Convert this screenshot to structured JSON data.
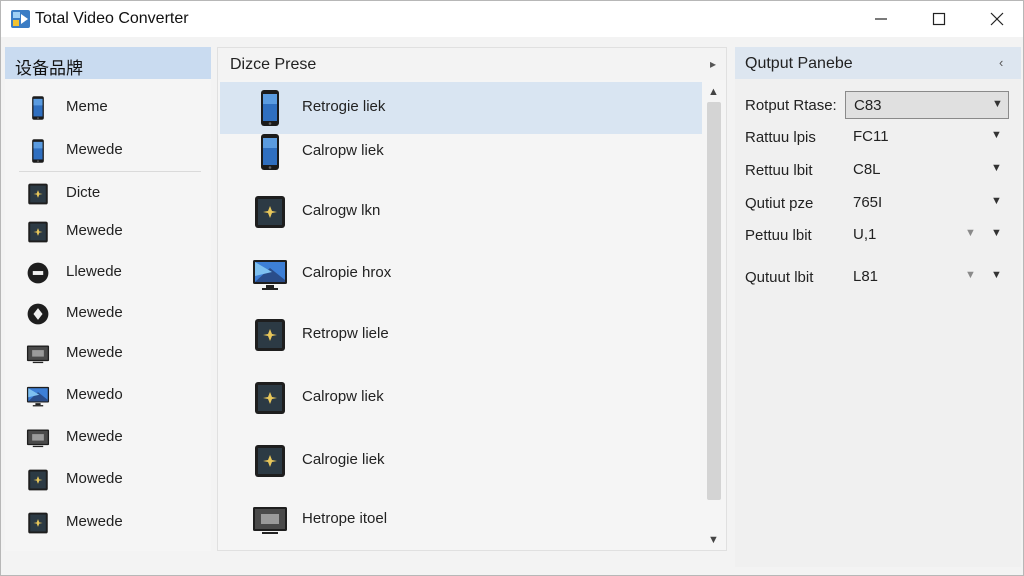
{
  "window": {
    "title": "Total Video Converter"
  },
  "left_panel": {
    "header": "设备品牌",
    "items": [
      {
        "label": "Meme",
        "icon": "phone-icon"
      },
      {
        "label": "Mewede",
        "icon": "phone-icon"
      },
      {
        "label": "Dicte",
        "icon": "tablet-icon"
      },
      {
        "label": "Mewede",
        "icon": "tablet-icon"
      },
      {
        "label": "Llewede",
        "icon": "round-device-icon"
      },
      {
        "label": "Mewede",
        "icon": "diamond-device-icon"
      },
      {
        "label": "Mewede",
        "icon": "tv-icon"
      },
      {
        "label": "Mewedo",
        "icon": "monitor-icon"
      },
      {
        "label": "Mewede",
        "icon": "tv-icon"
      },
      {
        "label": "Mowede",
        "icon": "tablet-icon"
      },
      {
        "label": "Mewede",
        "icon": "tablet-icon"
      }
    ]
  },
  "mid_panel": {
    "header": "Dizce Prese",
    "items": [
      {
        "label": "Retrogie liek",
        "icon": "phone-icon",
        "selected": true
      },
      {
        "label": "Calropw liek",
        "icon": "phone-icon",
        "selected": false
      },
      {
        "label": "Calrogw lkn",
        "icon": "tablet-icon",
        "selected": false
      },
      {
        "label": "Calropie hrox",
        "icon": "monitor-icon",
        "selected": false
      },
      {
        "label": "Retropw liele",
        "icon": "tablet-icon",
        "selected": false
      },
      {
        "label": "Calropw liek",
        "icon": "tablet-icon",
        "selected": false
      },
      {
        "label": "Calrogie liek",
        "icon": "tablet-icon",
        "selected": false
      },
      {
        "label": "Hetrope itoel",
        "icon": "tv-icon",
        "selected": false
      }
    ]
  },
  "right_panel": {
    "header": "Qutput Panebe",
    "options": [
      {
        "label": "Rotput Rtase:",
        "value": "C83",
        "active": true
      },
      {
        "label": "Rattuu lpis",
        "value": "FC11",
        "active": false
      },
      {
        "label": "Rettuu lbit",
        "value": "C8L",
        "active": false
      },
      {
        "label": "Qutiut pze",
        "value": "765I",
        "active": false
      },
      {
        "label": "Pettuu lbit",
        "value": "U,1",
        "active": false,
        "secondary_caret": true
      },
      {
        "label": "Qutuut lbit",
        "value": "L81",
        "active": false,
        "secondary_caret": true
      }
    ]
  },
  "colors": {
    "accent_header": "#c9dbf0",
    "selected_row": "#d9e5f2"
  }
}
